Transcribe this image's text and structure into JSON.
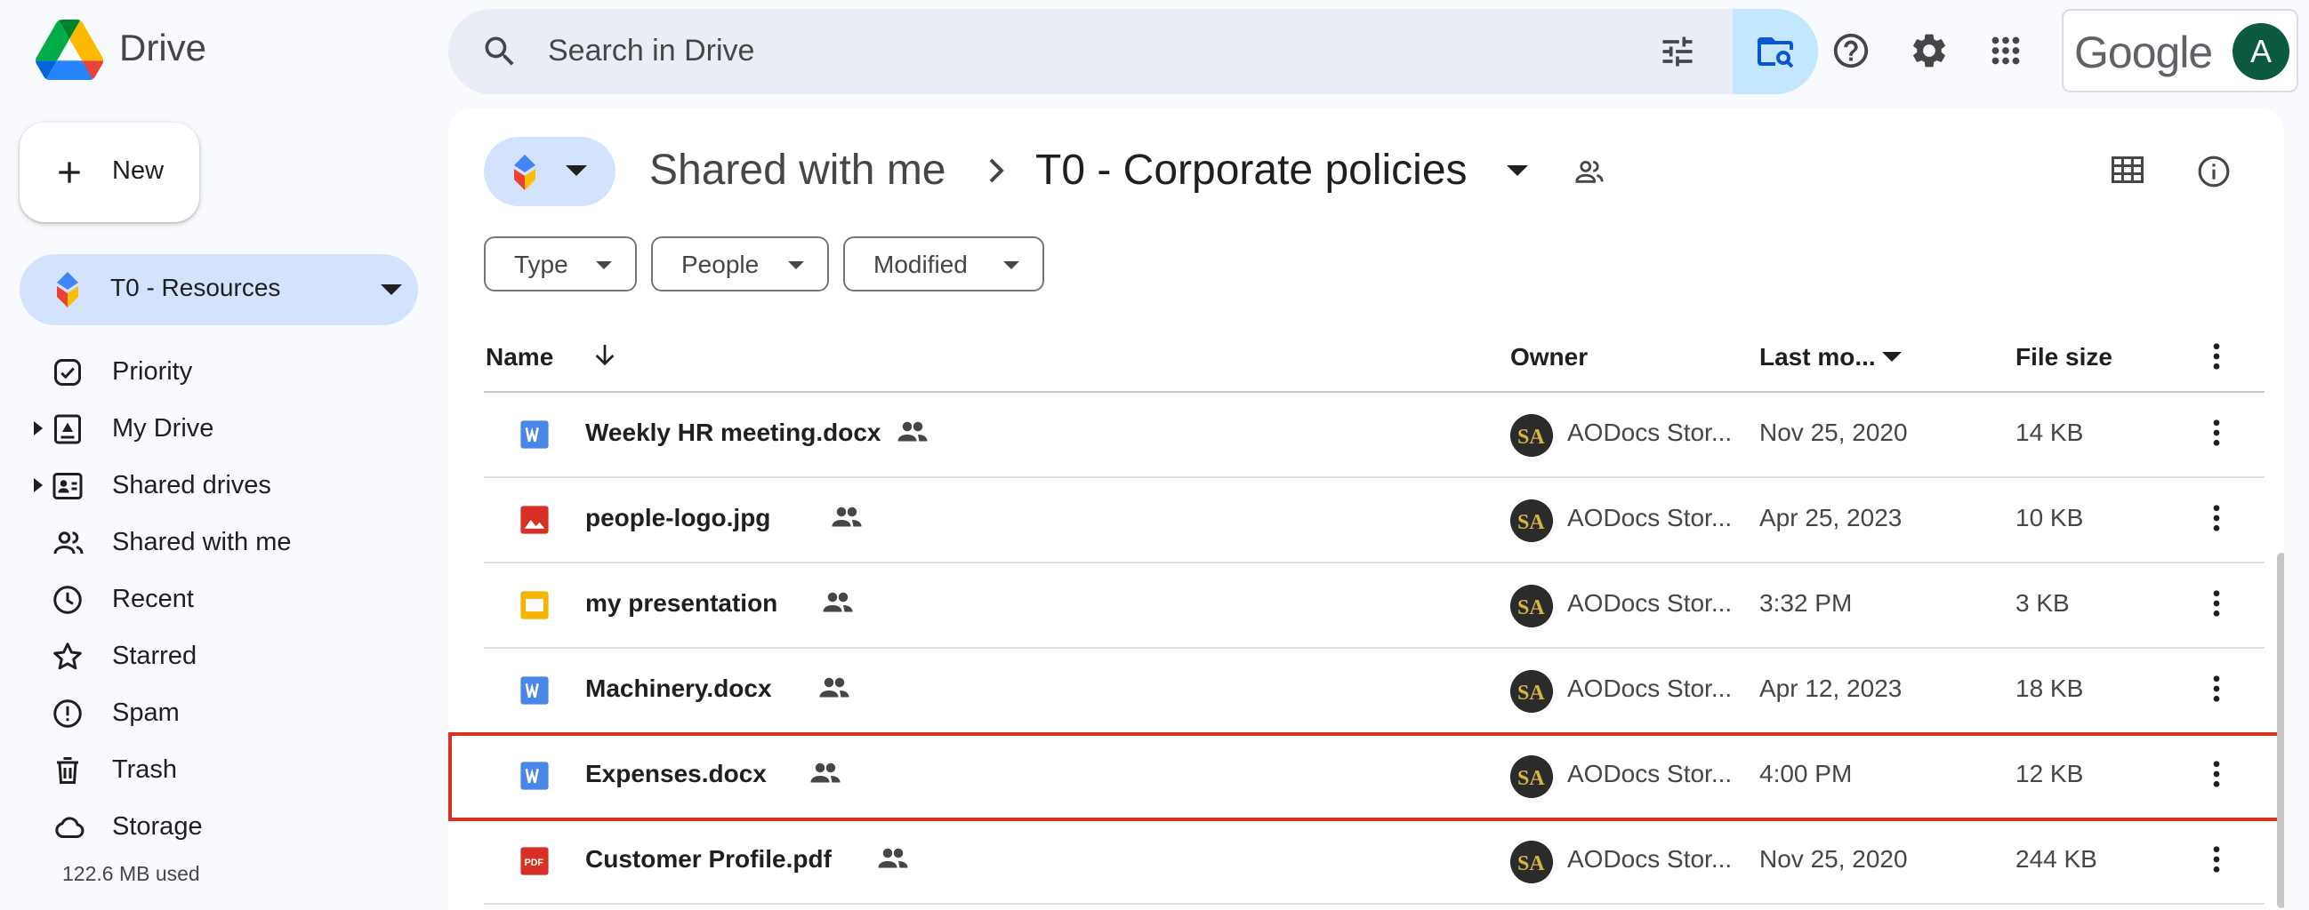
{
  "app": {
    "title": "Drive"
  },
  "search": {
    "placeholder": "Search in Drive"
  },
  "account": {
    "brand": "Google",
    "avatar_initial": "A"
  },
  "sidebar": {
    "new_label": "New",
    "selected_drive": "T0 - Resources",
    "items": [
      {
        "label": "Priority",
        "icon": "priority-icon"
      },
      {
        "label": "My Drive",
        "icon": "my-drive-icon"
      },
      {
        "label": "Shared drives",
        "icon": "shared-drives-icon"
      },
      {
        "label": "Shared with me",
        "icon": "shared-with-me-icon"
      },
      {
        "label": "Recent",
        "icon": "recent-icon"
      },
      {
        "label": "Starred",
        "icon": "star-icon"
      },
      {
        "label": "Spam",
        "icon": "spam-icon"
      },
      {
        "label": "Trash",
        "icon": "trash-icon"
      },
      {
        "label": "Storage",
        "icon": "cloud-icon"
      }
    ],
    "storage_used": "122.6 MB used"
  },
  "breadcrumb": {
    "parent": "Shared with me",
    "current": "T0 - Corporate policies"
  },
  "filters": [
    "Type",
    "People",
    "Modified"
  ],
  "columns": {
    "name": "Name",
    "owner": "Owner",
    "modified": "Last mo...",
    "size": "File size"
  },
  "files": [
    {
      "name": "Weekly HR meeting.docx",
      "type": "word",
      "owner": "AODocs Stor...",
      "modified": "Nov 25, 2020",
      "size": "14 KB"
    },
    {
      "name": "people-logo.jpg",
      "type": "image",
      "owner": "AODocs Stor...",
      "modified": "Apr 25, 2023",
      "size": "10 KB"
    },
    {
      "name": "my presentation",
      "type": "slides",
      "owner": "AODocs Stor...",
      "modified": "3:32 PM",
      "size": "3 KB"
    },
    {
      "name": "Machinery.docx",
      "type": "word",
      "owner": "AODocs Stor...",
      "modified": "Apr 12, 2023",
      "size": "18 KB"
    },
    {
      "name": "Expenses.docx",
      "type": "word",
      "owner": "AODocs Stor...",
      "modified": "4:00 PM",
      "size": "12 KB"
    },
    {
      "name": "Customer Profile.pdf",
      "type": "pdf",
      "owner": "AODocs Stor...",
      "modified": "Nov 25, 2020",
      "size": "244 KB"
    }
  ],
  "colors": {
    "accent": "#0b57d0",
    "selected_bg": "#d3e3fd",
    "highlight": "#d93025"
  }
}
